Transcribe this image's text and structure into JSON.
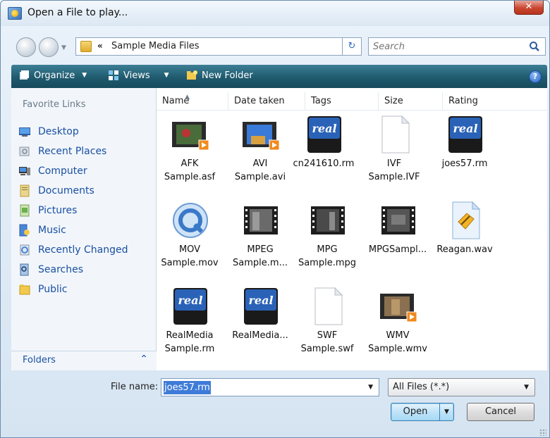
{
  "window": {
    "title": "Open a File to play..."
  },
  "address": {
    "path": "Sample Media Files",
    "breadcrumb_prefix": "«"
  },
  "search": {
    "placeholder": "Search"
  },
  "toolbar": {
    "organize": "Organize",
    "views": "Views",
    "new_folder": "New Folder",
    "help": "?"
  },
  "favorites": {
    "header": "Favorite Links",
    "items": [
      {
        "label": "Desktop",
        "icon": "desktop-icon"
      },
      {
        "label": "Recent Places",
        "icon": "recent-places-icon"
      },
      {
        "label": "Computer",
        "icon": "computer-icon"
      },
      {
        "label": "Documents",
        "icon": "documents-icon"
      },
      {
        "label": "Pictures",
        "icon": "pictures-icon"
      },
      {
        "label": "Music",
        "icon": "music-icon"
      },
      {
        "label": "Recently Changed",
        "icon": "recently-changed-icon"
      },
      {
        "label": "Searches",
        "icon": "searches-icon"
      },
      {
        "label": "Public",
        "icon": "public-icon"
      }
    ]
  },
  "folders": {
    "label": "Folders"
  },
  "columns": [
    "Name",
    "Date taken",
    "Tags",
    "Size",
    "Rating"
  ],
  "files": [
    {
      "label": "AFK\nSample.asf",
      "icon": "video-thumbnail-icon"
    },
    {
      "label": "AVI\nSample.avi",
      "icon": "video-thumbnail-icon"
    },
    {
      "label": "cn241610.rm",
      "icon": "realmedia-icon"
    },
    {
      "label": "IVF\nSample.IVF",
      "icon": "blank-file-icon"
    },
    {
      "label": "joes57.rm",
      "icon": "realmedia-icon"
    },
    {
      "label": "MOV\nSample.mov",
      "icon": "quicktime-icon"
    },
    {
      "label": "MPEG\nSample.m...",
      "icon": "film-strip-icon"
    },
    {
      "label": "MPG\nSample.mpg",
      "icon": "film-strip-icon"
    },
    {
      "label": "MPGSampl...",
      "icon": "film-strip-icon"
    },
    {
      "label": "Reagan.wav",
      "icon": "audio-file-icon"
    },
    {
      "label": "RealMedia\nSample.rm",
      "icon": "realmedia-icon"
    },
    {
      "label": "RealMedia...",
      "icon": "realmedia-icon"
    },
    {
      "label": "SWF\nSample.swf",
      "icon": "blank-file-icon"
    },
    {
      "label": "WMV\nSample.wmv",
      "icon": "video-thumbnail-icon"
    }
  ],
  "form": {
    "file_name_label": "File name:",
    "file_name_value": "joes57.rm",
    "file_type": "All Files (*.*)",
    "open_label": "Open",
    "cancel_label": "Cancel"
  },
  "colors": {
    "toolbar": "#1f5a6e",
    "link": "#1a4fa0",
    "selection": "#3f7bd8",
    "close": "#c9462f"
  }
}
